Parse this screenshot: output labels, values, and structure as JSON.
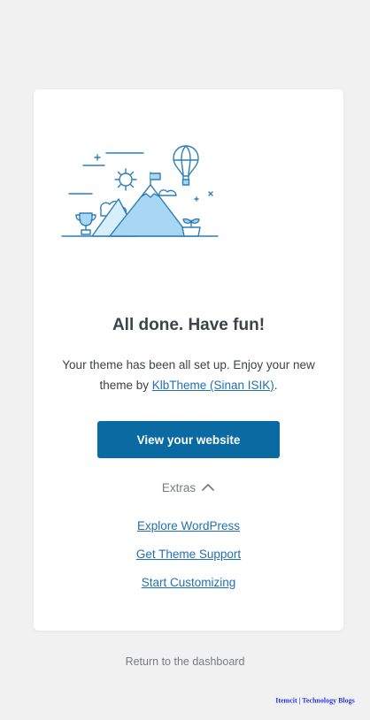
{
  "setup_complete": {
    "heading": "All done. Have fun!",
    "message_prefix": "Your theme has been all set up. Enjoy your new theme by",
    "author_link": "KlbTheme (Sinan ISIK)",
    "message_suffix": ".",
    "primary_button": "View your website",
    "extras_toggle": "Extras",
    "extras_links": [
      "Explore WordPress",
      "Get Theme Support",
      "Start Customizing"
    ]
  },
  "footer": {
    "return_link": "Return to the dashboard"
  },
  "watermark": {
    "text": "Itemcit | Technology Blogs"
  },
  "icons": {
    "illustration": "mountain-balloon-illustration",
    "extras_toggle": "chevron-up-icon"
  },
  "colors": {
    "background": "#f1f1f1",
    "card": "#ffffff",
    "primary_button": "#0a6aa1",
    "link": "#2271b1",
    "illustration_stroke": "#2d7fb8",
    "illustration_fill": "#a9d6f2"
  }
}
